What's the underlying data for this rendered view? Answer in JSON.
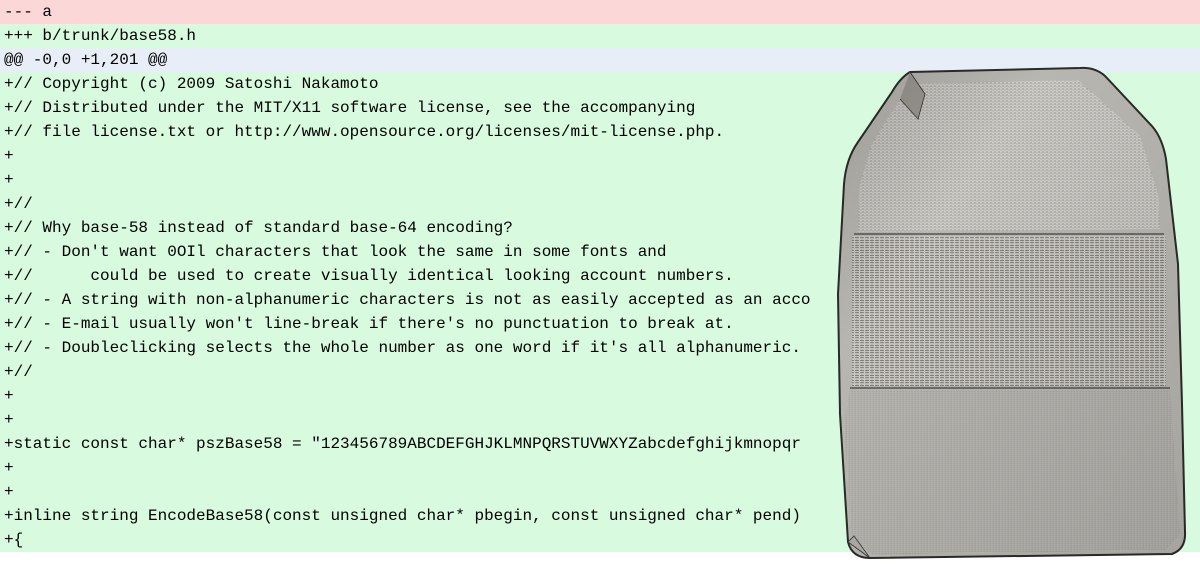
{
  "diff": {
    "lines": [
      {
        "type": "remove",
        "text": "--- a"
      },
      {
        "type": "add",
        "text": "+++ b/trunk/base58.h"
      },
      {
        "type": "hunk",
        "text": "@@ -0,0 +1,201 @@"
      },
      {
        "type": "add",
        "text": "+// Copyright (c) 2009 Satoshi Nakamoto"
      },
      {
        "type": "add",
        "text": "+// Distributed under the MIT/X11 software license, see the accompanying"
      },
      {
        "type": "add",
        "text": "+// file license.txt or http://www.opensource.org/licenses/mit-license.php."
      },
      {
        "type": "add",
        "text": "+"
      },
      {
        "type": "add",
        "text": "+"
      },
      {
        "type": "add",
        "text": "+//"
      },
      {
        "type": "add",
        "text": "+// Why base-58 instead of standard base-64 encoding?"
      },
      {
        "type": "add",
        "text": "+// - Don't want 0OIl characters that look the same in some fonts and"
      },
      {
        "type": "add",
        "text": "+//      could be used to create visually identical looking account numbers."
      },
      {
        "type": "add",
        "text": "+// - A string with non-alphanumeric characters is not as easily accepted as an acco"
      },
      {
        "type": "add",
        "text": "+// - E-mail usually won't line-break if there's no punctuation to break at."
      },
      {
        "type": "add",
        "text": "+// - Doubleclicking selects the whole number as one word if it's all alphanumeric."
      },
      {
        "type": "add",
        "text": "+//"
      },
      {
        "type": "add",
        "text": "+"
      },
      {
        "type": "add",
        "text": "+"
      },
      {
        "type": "add",
        "text": "+static const char* pszBase58 = \"123456789ABCDEFGHJKLMNPQRSTUVWXYZabcdefghijkmnopqr"
      },
      {
        "type": "add",
        "text": "+"
      },
      {
        "type": "add",
        "text": "+"
      },
      {
        "type": "add",
        "text": "+inline string EncodeBase58(const unsigned char* pbegin, const unsigned char* pend)"
      },
      {
        "type": "add",
        "text": "+{"
      }
    ]
  },
  "image": {
    "name": "rosetta-stone"
  }
}
